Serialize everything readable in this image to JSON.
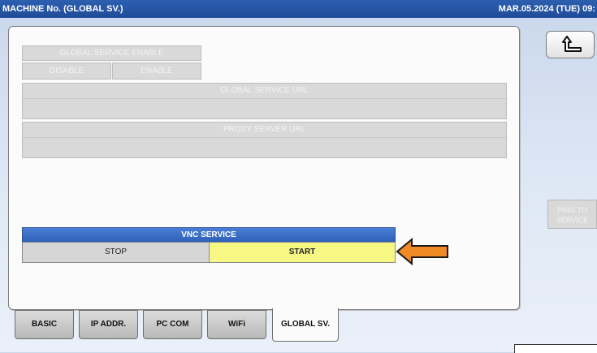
{
  "header": {
    "title": "MACHINE No. (GLOBAL SV.)",
    "datetime": "MAR.05.2024 (TUE) 09:"
  },
  "global_service_enable": {
    "title": "GLOBAL SERVICE ENABLE",
    "disable_label": "DISABLE",
    "enable_label": "ENABLE"
  },
  "global_service_url": {
    "label": "GLOBAL SERVICE URL",
    "value": ""
  },
  "proxy_server_url": {
    "label": "PROXY SERVER URL",
    "value": ""
  },
  "vnc_service": {
    "title": "VNC SERVICE",
    "stop_label": "STOP",
    "start_label": "START",
    "selected": "START"
  },
  "side": {
    "back_icon": "return-arrow-icon",
    "ping_label_line1": "PING TO",
    "ping_label_line2": "SERVICE"
  },
  "tabs": [
    {
      "label": "BASIC"
    },
    {
      "label": "IP ADDR."
    },
    {
      "label": "PC COM"
    },
    {
      "label": "WiFi"
    },
    {
      "label": "GLOBAL SV.",
      "active": true
    }
  ],
  "colors": {
    "title_bar": "#1f4c98",
    "vnc_header": "#3a6cc6",
    "selected_button": "#f7f784",
    "annotation_arrow": "#f08a24"
  }
}
